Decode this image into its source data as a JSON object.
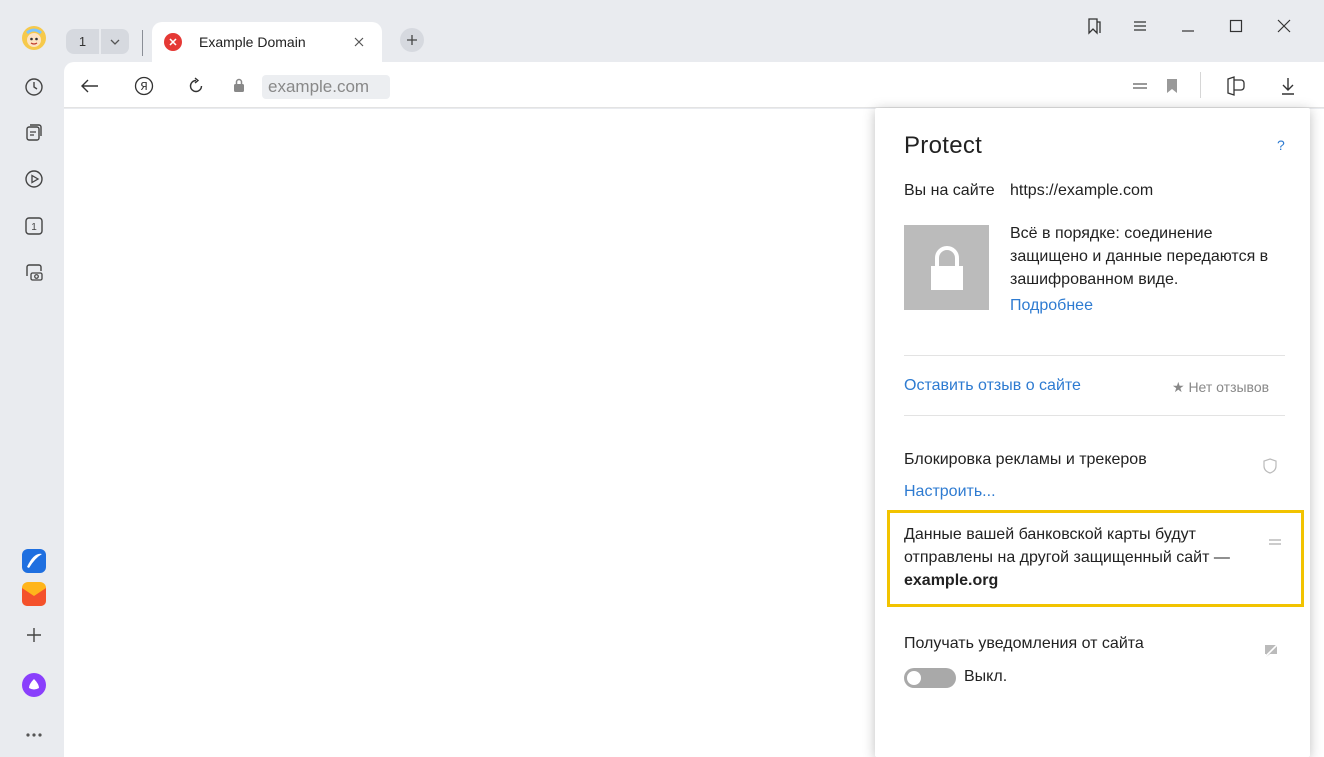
{
  "tab_strip": {
    "tab_count": "1",
    "active_tab_title": "Example Domain"
  },
  "address_bar": {
    "url": "example.com"
  },
  "protect_popup": {
    "title": "Protect",
    "help": "?",
    "site_label": "Вы на сайте",
    "site_url": "https://example.com",
    "status_text": "Всё в порядке: соединение защищено и данные передаются в зашифрованном виде.",
    "more_link": "Подробнее",
    "review_link": "Оставить отзыв о сайте",
    "no_reviews": "★ Нет отзывов",
    "ad_block_label": "Блокировка рекламы и трекеров",
    "tune_link": "Настроить...",
    "card_text": "Данные вашей банковской карты будут отправлены на другой защищенный сайт —",
    "card_target": "example.org",
    "notifications_label": "Получать уведомления от сайта",
    "notifications_state": "Выкл.",
    "notifications_enabled": false
  },
  "colors": {
    "link": "#2e7bd1",
    "highlight": "#f2c300",
    "sidebar_bg": "#e9ebef"
  }
}
